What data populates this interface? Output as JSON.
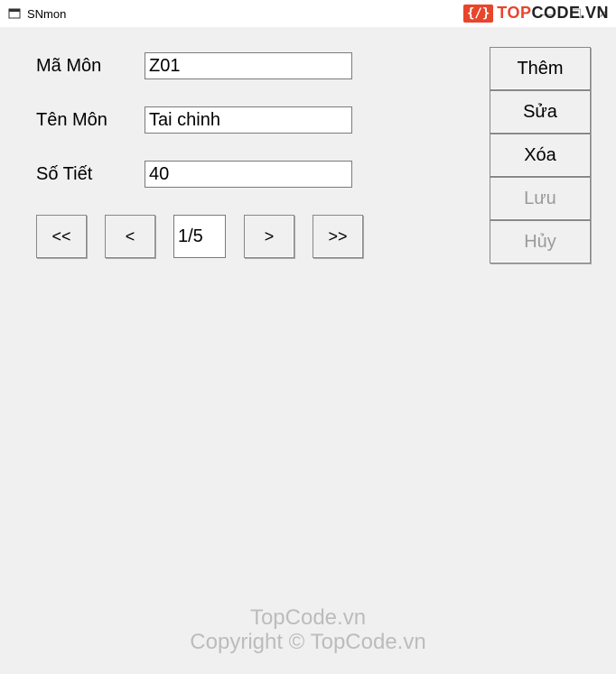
{
  "window": {
    "title": "SNmon"
  },
  "form": {
    "maMon": {
      "label": "Mã Môn",
      "value": "Z01"
    },
    "tenMon": {
      "label": "Tên Môn",
      "value": "Tai chinh"
    },
    "soTiet": {
      "label": "Số Tiết",
      "value": "40"
    }
  },
  "pagination": {
    "first": "<<",
    "prev": "<",
    "page": "1/5",
    "next": ">",
    "last": ">>"
  },
  "actions": {
    "them": "Thêm",
    "sua": "Sửa",
    "xoa": "Xóa",
    "luu": "Lưu",
    "huy": "Hủy"
  },
  "watermark": {
    "top_logo": "{/}",
    "top_text1": "TOP",
    "top_text2": "CODE.VN",
    "bottom_line1": "TopCode.vn",
    "bottom_line2": "Copyright © TopCode.vn"
  }
}
